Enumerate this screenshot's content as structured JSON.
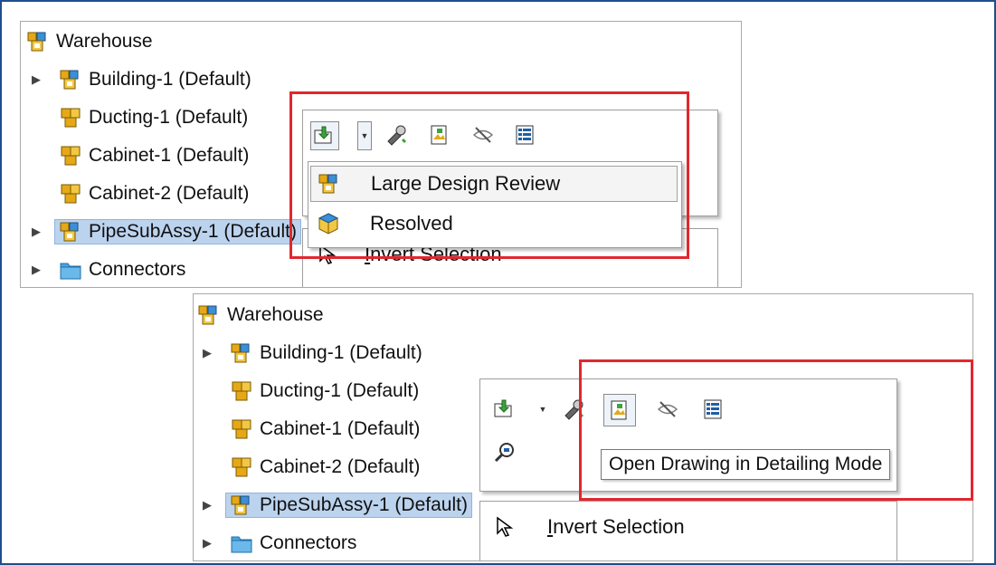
{
  "top_tree": {
    "items": [
      {
        "label": "Warehouse",
        "icon": "assembly-icon",
        "arrow": ""
      },
      {
        "label": "Building-1 (Default)",
        "icon": "assembly-icon",
        "arrow": "▶"
      },
      {
        "label": "Ducting-1 (Default)",
        "icon": "part-icon",
        "arrow": ""
      },
      {
        "label": "Cabinet-1 (Default)",
        "icon": "part-icon",
        "arrow": ""
      },
      {
        "label": "Cabinet-2 (Default)",
        "icon": "part-icon",
        "arrow": ""
      },
      {
        "label": "PipeSubAssy-1 (Default)",
        "icon": "assembly-icon",
        "arrow": "▶"
      },
      {
        "label": "Connectors",
        "icon": "folder-icon",
        "arrow": "▶"
      }
    ]
  },
  "top_menu": {
    "items": [
      {
        "label": "Large Design Review",
        "icon": "large-design-review-icon"
      },
      {
        "label": "Resolved",
        "icon": "resolved-icon"
      }
    ],
    "behind_label": "Invert Selection"
  },
  "bottom_tree": {
    "items": [
      {
        "label": "Warehouse",
        "icon": "assembly-icon",
        "arrow": ""
      },
      {
        "label": "Building-1 (Default)",
        "icon": "assembly-icon",
        "arrow": "▶"
      },
      {
        "label": "Ducting-1 (Default)",
        "icon": "part-icon",
        "arrow": ""
      },
      {
        "label": "Cabinet-1 (Default)",
        "icon": "part-icon",
        "arrow": ""
      },
      {
        "label": "Cabinet-2 (Default)",
        "icon": "part-icon",
        "arrow": ""
      },
      {
        "label": "PipeSubAssy-1 (Default)",
        "icon": "assembly-icon",
        "arrow": "▶"
      },
      {
        "label": "Connectors",
        "icon": "folder-icon",
        "arrow": "▶"
      }
    ]
  },
  "bottom_menu": {
    "tooltip": "Open Drawing in Detailing Mode",
    "invert_label": "Invert Selection"
  },
  "colors": {
    "frame": "#1f4e8c",
    "highlight": "#e0282e",
    "selection": "#bcd3ee"
  }
}
